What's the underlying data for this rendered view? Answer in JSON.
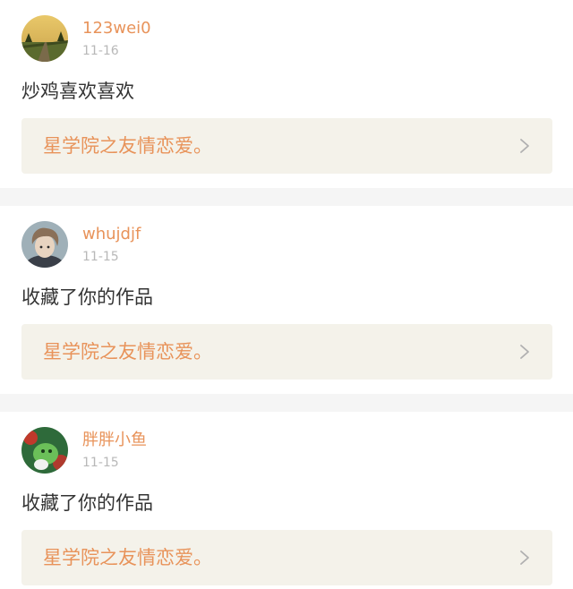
{
  "notifications": [
    {
      "username": "123wei0",
      "date": "11-16",
      "message": "炒鸡喜欢喜欢",
      "work_title": "星学院之友情恋爱。",
      "avatar_icon": "landscape-road-avatar"
    },
    {
      "username": "whujdjf",
      "date": "11-15",
      "message": "收藏了你的作品",
      "work_title": "星学院之友情恋爱。",
      "avatar_icon": "person-portrait-avatar"
    },
    {
      "username": "胖胖小鱼",
      "date": "11-15",
      "message": "收藏了你的作品",
      "work_title": "星学院之友情恋爱。",
      "avatar_icon": "green-character-avatar"
    }
  ],
  "colors": {
    "accent": "#e8935a",
    "date": "#b8b8b8",
    "text": "#333333",
    "link_bg": "#f4f2ea",
    "divider": "#f5f5f5"
  }
}
